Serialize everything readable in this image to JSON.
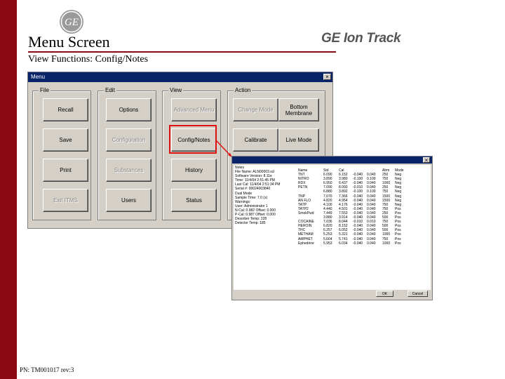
{
  "slide": {
    "title": "Menu Screen",
    "subtitle": "View Functions: Config/Notes",
    "brand": "GE Ion Track",
    "footer": "PN: TM001017 rev:3",
    "accent_color": "#8b0a14",
    "logo_text": "GE"
  },
  "menu_window": {
    "title": "Menu",
    "close": "×",
    "groups": [
      {
        "label": "File",
        "buttons": [
          {
            "label": "Recall",
            "enabled": true
          },
          {
            "label": "Save",
            "enabled": true
          },
          {
            "label": "Print",
            "enabled": true
          },
          {
            "label": "Exit ITMS",
            "enabled": false
          }
        ]
      },
      {
        "label": "Edit",
        "buttons": [
          {
            "label": "Options",
            "enabled": true
          },
          {
            "label": "Configuration",
            "enabled": false
          },
          {
            "label": "Substances",
            "enabled": false
          },
          {
            "label": "Users",
            "enabled": true
          }
        ]
      },
      {
        "label": "View",
        "buttons": [
          {
            "label": "Advanced Menu",
            "enabled": false
          },
          {
            "label": "Config/Notes",
            "enabled": true
          },
          {
            "label": "History",
            "enabled": true
          },
          {
            "label": "Status",
            "enabled": true
          }
        ]
      },
      {
        "label": "Action",
        "buttons": [
          {
            "label": "Change Mode",
            "enabled": false
          },
          {
            "label": "Calibrate",
            "enabled": true
          },
          {
            "label": "Bottom Membrane",
            "enabled": true
          },
          {
            "label": "Live Mode",
            "enabled": true
          }
        ]
      }
    ]
  },
  "notes_window": {
    "close": "×",
    "notes_header": "Notes",
    "notes_lines": [
      "File Name: ALN00003.scl",
      "Software Version: 8.11e",
      "Time: 11/4/04 2:51:45 PM",
      "Last Cal: 11/4/04 2:51:34 PM",
      "Serial #: 00024003840",
      "Dual Mode",
      "Sample Time: 7.0 (s)",
      "Warnings:",
      "User: Administrator 1",
      "N-Cal: 0.982 Offset: 0.000",
      "P-Cal: 0.987 Offset: 0.000",
      "Desorber Temp: 228",
      "Detector Temp: 185"
    ],
    "columns": [
      "Name",
      "Std",
      "Cal",
      "",
      "",
      "Alrm",
      "Mode"
    ],
    "rows": [
      [
        "TNT",
        "6.090",
        "6.152",
        "-0.040",
        "0.040",
        "250",
        "Neg"
      ],
      [
        "NITRO",
        "3.890",
        "3.980",
        "-0.100",
        "0.100",
        "750",
        "Neg"
      ],
      [
        "RDX",
        "6.950",
        "6.437",
        "-0.040",
        "0.040",
        "1000",
        "Neg"
      ],
      [
        "PETN",
        "7.090",
        "8.093",
        "-0.010",
        "0.040",
        "250",
        "Neg"
      ],
      [
        "",
        "6.880",
        "3.892",
        "-0.100",
        "0.100",
        "750",
        "Neg"
      ],
      [
        "TNP",
        "7.070",
        "7.366",
        "-0.040",
        "0.040",
        "1500",
        "Neg"
      ],
      [
        "AN FLO",
        "4.820",
        "4.954",
        "-0.040",
        "0.040",
        "1500",
        "Neg"
      ],
      [
        "TATP",
        "4.100",
        "4.176",
        "-0.040",
        "0.040",
        "750",
        "Neg"
      ],
      [
        "TATP2",
        "4.440",
        "4.501",
        "-0.040",
        "0.040",
        "750",
        "Pos"
      ],
      [
        "SmokPwd",
        "7.449",
        "7.553",
        "-0.040",
        "0.040",
        "250",
        "Pos"
      ],
      [
        "",
        "3.880",
        "3.914",
        "-0.040",
        "0.040",
        "500",
        "Pos"
      ],
      [
        "COCAINE",
        "7.036",
        "8.044",
        "-0.010",
        "0.010",
        "750",
        "Pos"
      ],
      [
        "HEROIN",
        "6.820",
        "8.152",
        "-0.040",
        "0.040",
        "500",
        "Pos"
      ],
      [
        "THC",
        "6.257",
        "6.052",
        "-0.040",
        "0.040",
        "500",
        "Pos"
      ],
      [
        "METHAM",
        "5.253",
        "5.321",
        "-0.040",
        "0.040",
        "1000",
        "Pos"
      ],
      [
        "AMPHET",
        "5.664",
        "5.741",
        "-0.040",
        "0.040",
        "750",
        "Pos"
      ],
      [
        "Ephedrine",
        "5.953",
        "6.034",
        "-0.040",
        "0.040",
        "1000",
        "Pos"
      ]
    ],
    "ok_label": "OK",
    "cancel_label": "Cancel"
  },
  "colors": {
    "highlight": "#dd1111",
    "titlebar": "#0a246a",
    "window_face": "#d4d0c8"
  }
}
